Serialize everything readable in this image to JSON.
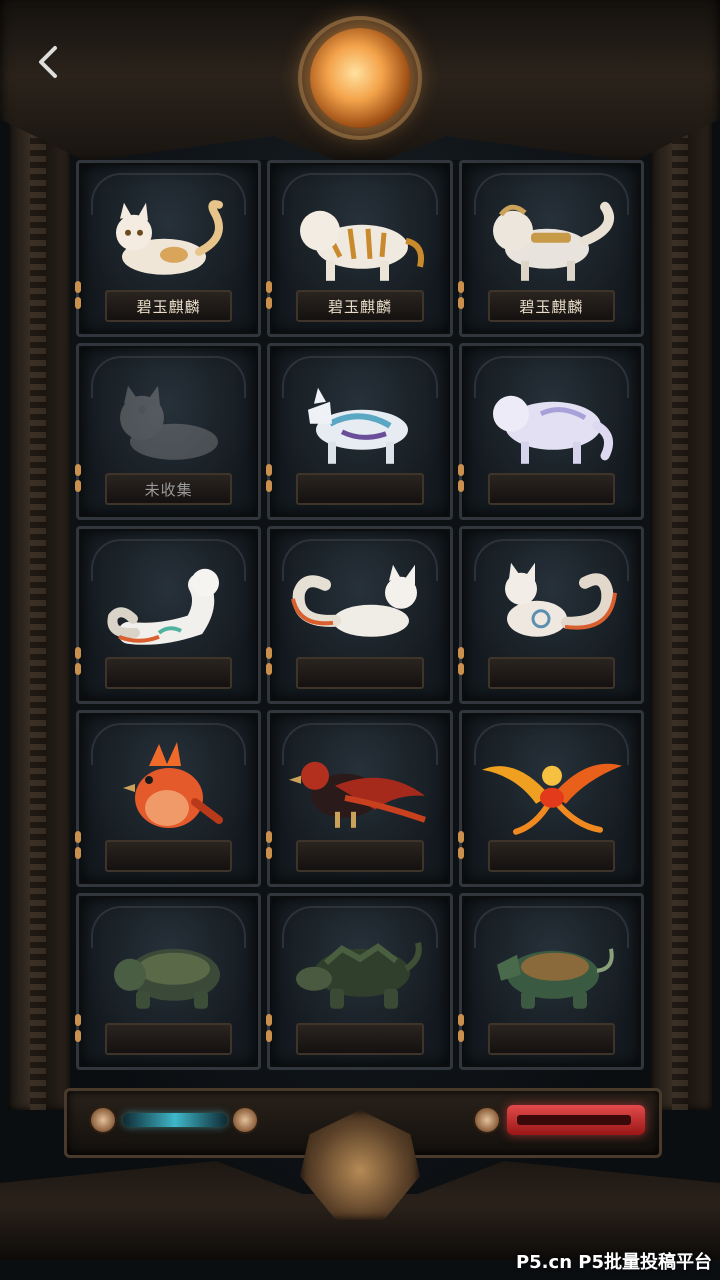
{
  "header": {
    "back_icon": "chevron-left-icon",
    "orb_icon": "glowing-orb-icon"
  },
  "collection": [
    {
      "name": "碧玉麒麟",
      "creature": "white-cat",
      "collected": true
    },
    {
      "name": "碧玉麒麟",
      "creature": "white-tiger",
      "collected": true
    },
    {
      "name": "碧玉麒麟",
      "creature": "golden-armored-beast",
      "collected": true
    },
    {
      "name": "未收集",
      "creature": "grey-cat-silhouette",
      "collected": false
    },
    {
      "name": "",
      "creature": "blue-white-wolf",
      "collected": true
    },
    {
      "name": "",
      "creature": "white-lavender-wolf",
      "collected": true
    },
    {
      "name": "",
      "creature": "white-ferret",
      "collected": true
    },
    {
      "name": "",
      "creature": "white-fox",
      "collected": true
    },
    {
      "name": "",
      "creature": "white-fox-spirit",
      "collected": true
    },
    {
      "name": "",
      "creature": "red-bird",
      "collected": true
    },
    {
      "name": "",
      "creature": "red-black-raven",
      "collected": true
    },
    {
      "name": "",
      "creature": "flame-phoenix",
      "collected": true
    },
    {
      "name": "",
      "creature": "dark-turtle",
      "collected": true
    },
    {
      "name": "",
      "creature": "green-snapping-turtle",
      "collected": true
    },
    {
      "name": "",
      "creature": "jade-dragon-turtle",
      "collected": true
    }
  ],
  "footer": {
    "watermark": "P5.cn P5批量投稿平台"
  },
  "colors": {
    "gold": "#c9904e",
    "glow_blue": "#3fb7c9",
    "glow_red": "#e24b4b",
    "orb": "#f4a34a"
  }
}
